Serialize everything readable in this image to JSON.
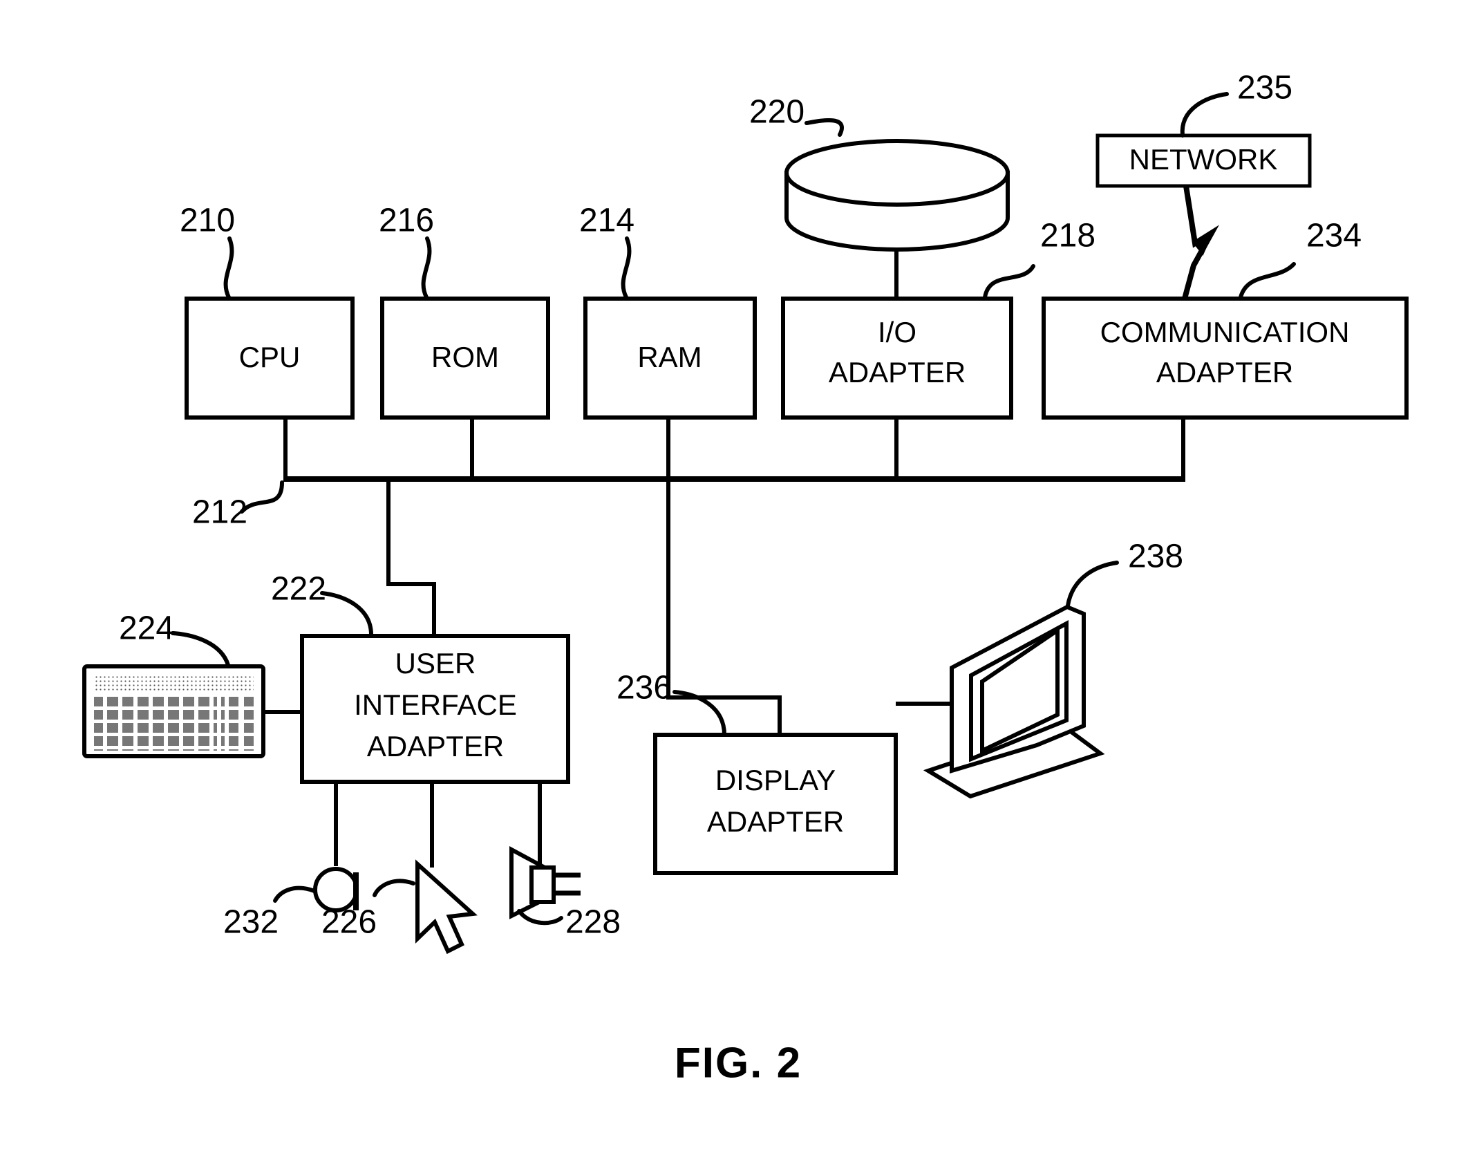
{
  "figure": {
    "caption": "FIG. 2",
    "title": "Data processing system block diagram"
  },
  "blocks": [
    {
      "id": "cpu",
      "label": "CPU",
      "ref": "210"
    },
    {
      "id": "rom",
      "label": "ROM",
      "ref": "216"
    },
    {
      "id": "ram",
      "label": "RAM",
      "ref": "214"
    },
    {
      "id": "io_adapter",
      "label_line1": "I/O",
      "label_line2": "ADAPTER",
      "ref": "218"
    },
    {
      "id": "comm_adapter",
      "label_line1": "COMMUNICATION",
      "label_line2": "ADAPTER",
      "ref": "234"
    },
    {
      "id": "network",
      "label": "NETWORK",
      "ref": "235"
    },
    {
      "id": "ui_adapter",
      "label_line1": "USER",
      "label_line2": "INTERFACE",
      "label_line3": "ADAPTER",
      "ref": "222"
    },
    {
      "id": "display_adapter",
      "label_line1": "DISPLAY",
      "label_line2": "ADAPTER",
      "ref": "236"
    }
  ],
  "peripherals": [
    {
      "id": "disk_storage",
      "name": "disk-storage-cylinder",
      "ref": "220"
    },
    {
      "id": "keyboard",
      "name": "keyboard",
      "ref": "224"
    },
    {
      "id": "microphone",
      "name": "microphone",
      "ref": "232"
    },
    {
      "id": "mouse",
      "name": "mouse-pointer",
      "ref": "226"
    },
    {
      "id": "speaker",
      "name": "speaker",
      "ref": "228"
    },
    {
      "id": "monitor",
      "name": "display-monitor",
      "ref": "238"
    }
  ],
  "bus": {
    "label": "system-bus",
    "ref": "212"
  },
  "refs": {
    "cpu": "210",
    "bus": "212",
    "ram": "214",
    "rom": "216",
    "io_adapter": "218",
    "disk": "220",
    "ui_adapter": "222",
    "keyboard": "224",
    "mouse": "226",
    "speaker": "228",
    "microphone": "232",
    "comm_adapter": "234",
    "network": "235",
    "display_adapter": "236",
    "monitor": "238"
  },
  "labels": {
    "cpu": "CPU",
    "rom": "ROM",
    "ram": "RAM",
    "io_1": "I/O",
    "io_2": "ADAPTER",
    "comm_1": "COMMUNICATION",
    "comm_2": "ADAPTER",
    "network": "NETWORK",
    "ui_1": "USER",
    "ui_2": "INTERFACE",
    "ui_3": "ADAPTER",
    "disp_1": "DISPLAY",
    "disp_2": "ADAPTER",
    "caption": "FIG. 2"
  },
  "colors": {
    "stroke": "#000000",
    "fill": "#ffffff",
    "shade": "#c8c8c8"
  }
}
